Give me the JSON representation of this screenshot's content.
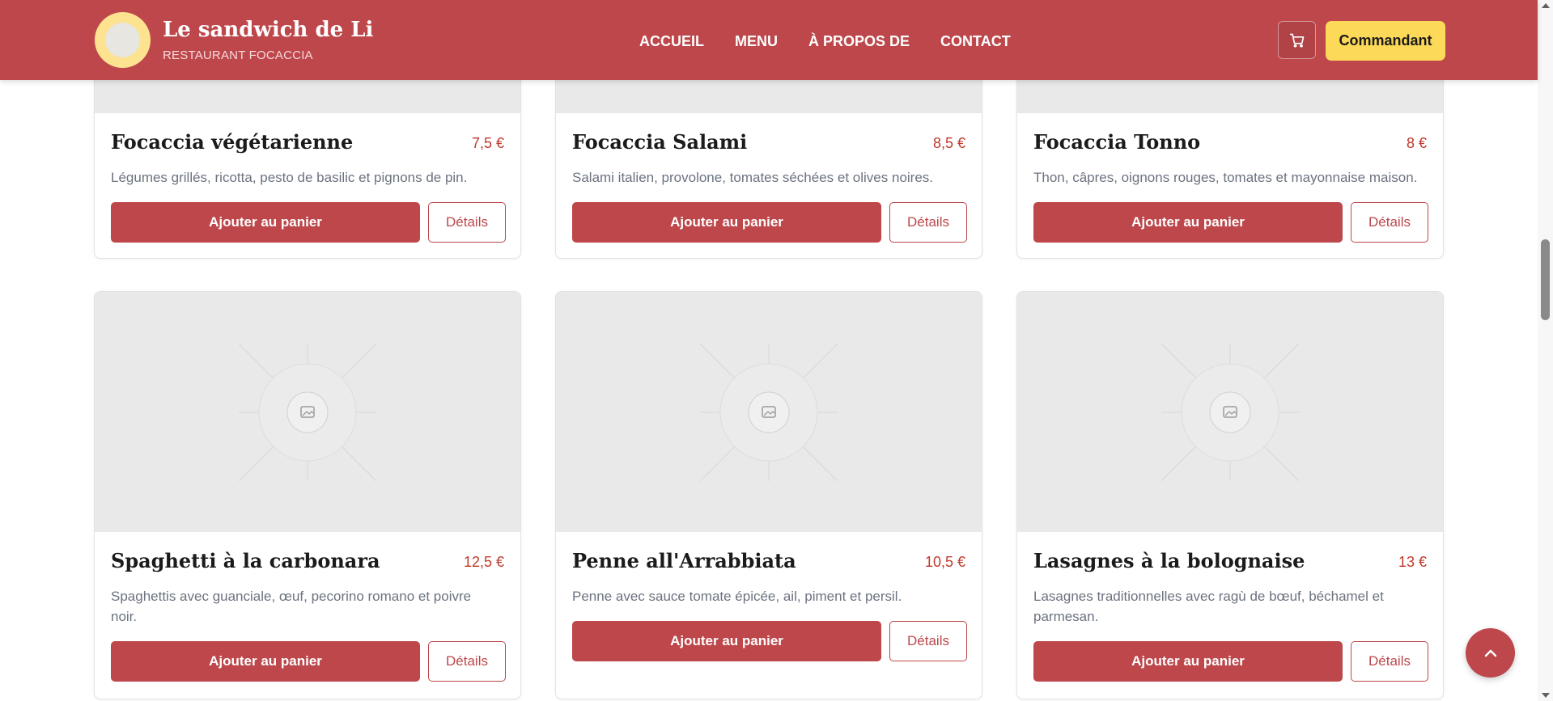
{
  "brand": {
    "title": "Le sandwich de Li",
    "subtitle": "RESTAURANT FOCACCIA"
  },
  "nav": {
    "items": [
      "ACCUEIL",
      "MENU",
      "À PROPOS DE",
      "CONTACT"
    ]
  },
  "header": {
    "cart_icon": "cart-icon",
    "order_label": "Commandant"
  },
  "colors": {
    "primary": "#bd474b",
    "accent": "#fcd958",
    "price": "#c0392b",
    "image_bg": "#e9e9e9"
  },
  "cards": [
    {
      "title": "Focaccia végétarienne",
      "price": "7,5 €",
      "desc": "Légumes grillés, ricotta, pesto de basilic et pignons de pin.",
      "add": "Ajouter au panier",
      "details": "Détails"
    },
    {
      "title": "Focaccia Salami",
      "price": "8,5 €",
      "desc": "Salami italien, provolone, tomates séchées et olives noires.",
      "add": "Ajouter au panier",
      "details": "Détails"
    },
    {
      "title": "Focaccia Tonno",
      "price": "8 €",
      "desc": "Thon, câpres, oignons rouges, tomates et mayonnaise maison.",
      "add": "Ajouter au panier",
      "details": "Détails"
    },
    {
      "title": "Spaghetti à la carbonara",
      "price": "12,5 €",
      "desc": "Spaghettis avec guanciale, œuf, pecorino romano et poivre noir.",
      "add": "Ajouter au panier",
      "details": "Détails"
    },
    {
      "title": "Penne all'Arrabbiata",
      "price": "10,5 €",
      "desc": "Penne avec sauce tomate épicée, ail, piment et persil.",
      "add": "Ajouter au panier",
      "details": "Détails"
    },
    {
      "title": "Lasagnes à la bolognaise",
      "price": "13 €",
      "desc": "Lasagnes traditionnelles avec ragù de bœuf, béchamel et parmesan.",
      "add": "Ajouter au panier",
      "details": "Détails"
    }
  ],
  "scroll_top_icon": "chevron-up-icon"
}
